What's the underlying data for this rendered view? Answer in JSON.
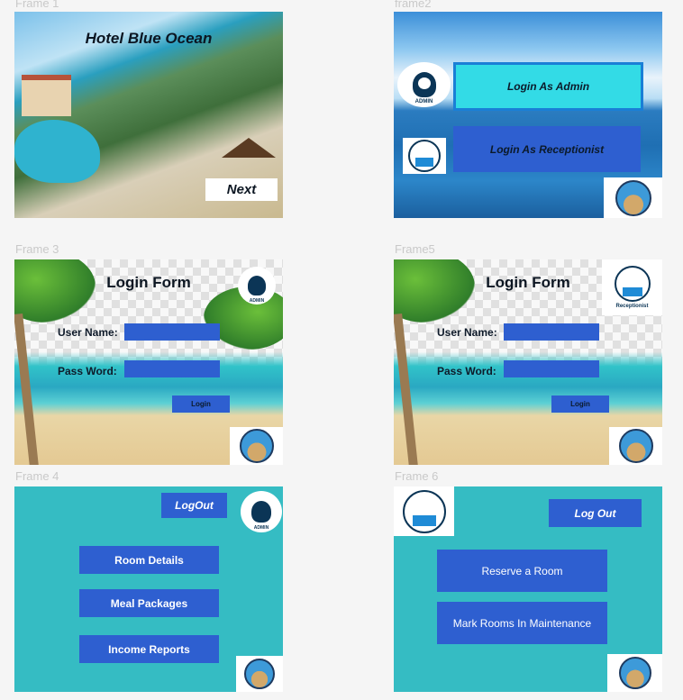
{
  "frames": {
    "f1": {
      "label": "Frame 1",
      "title": "Hotel Blue Ocean",
      "next_label": "Next"
    },
    "f2": {
      "label": "frame2",
      "admin_badge": "ADMIN",
      "login_admin": "Login As Admin",
      "login_receptionist": "Login As Receptionist"
    },
    "f3": {
      "label": "Frame 3",
      "title": "Login Form",
      "user_label": "User Name:",
      "pass_label": "Pass Word:",
      "login_label": "Login",
      "admin_badge": "ADMIN"
    },
    "f5": {
      "label": "Frame5",
      "title": "Login Form",
      "user_label": "User Name:",
      "pass_label": "Pass Word:",
      "login_label": "Login",
      "receptionist_badge": "Receptionist"
    },
    "f4": {
      "label": "Frame 4",
      "logout_label": "LogOut",
      "admin_badge": "ADMIN",
      "menu": [
        "Room Details",
        "Meal Packages",
        "Income Reports"
      ]
    },
    "f6": {
      "label": "Frame 6",
      "logout_label": "Log Out",
      "menu": [
        "Reserve a Room",
        "Mark Rooms In Maintenance"
      ]
    }
  },
  "colors": {
    "button_blue": "#2e5fd0",
    "admin_highlight": "#33dbe6",
    "teal_bg": "#35bcc3"
  }
}
